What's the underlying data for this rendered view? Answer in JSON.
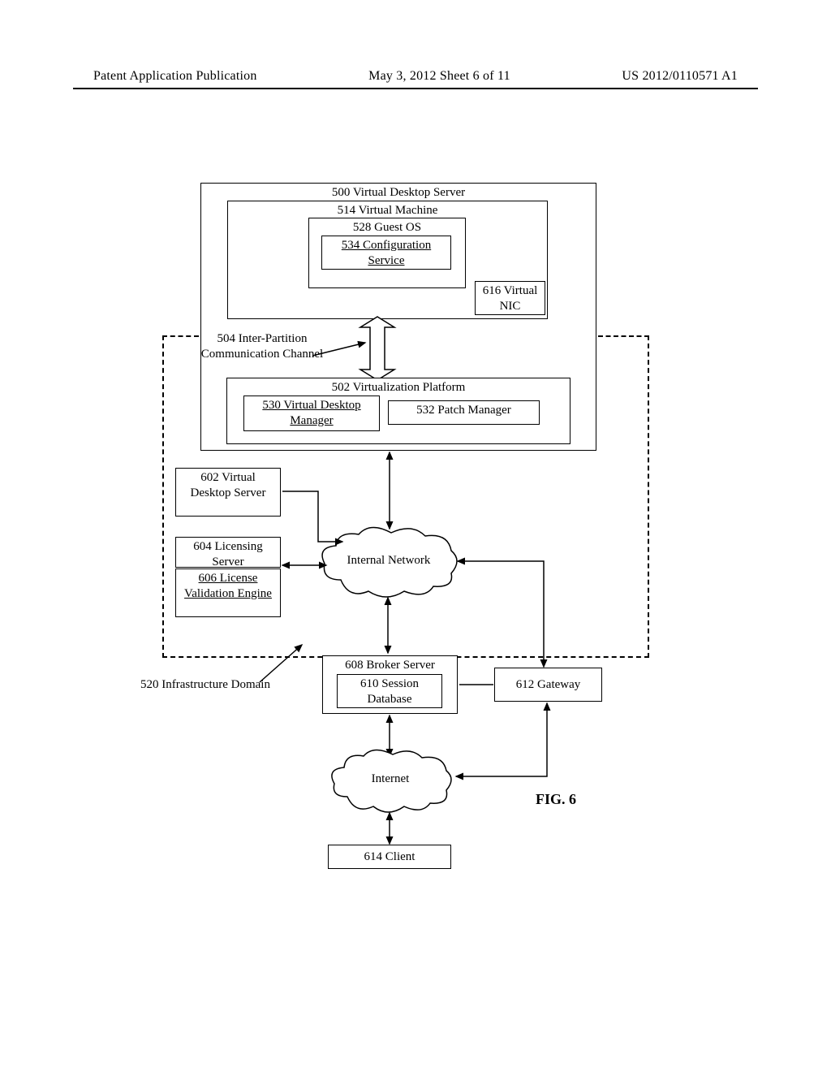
{
  "header": {
    "left": "Patent Application Publication",
    "mid": "May 3, 2012  Sheet 6 of 11",
    "right": "US 2012/0110571 A1"
  },
  "figure_label": "FIG. 6",
  "vds_outer_title": "500 Virtual Desktop Server",
  "vm": {
    "title": "514 Virtual Machine",
    "guest_os": "528 Guest OS",
    "config_service": "534 Configuration Service",
    "vnic": "616 Virtual NIC"
  },
  "ipc_channel": "504 Inter-Partition Communication Channel",
  "vplatform": {
    "title": "502 Virtualization Platform",
    "vdm": "530 Virtual Desktop Manager",
    "patch": "532 Patch Manager"
  },
  "second_vds": "602 Virtual Desktop Server",
  "licensing": {
    "server": "604 Licensing Server",
    "engine": "606 License Validation Engine"
  },
  "infra_domain_label": "520 Infrastructure Domain",
  "internal_network": "Internal Network",
  "broker": {
    "title": "608 Broker Server",
    "session_db": "610 Session Database"
  },
  "gateway": "612 Gateway",
  "internet": "Internet",
  "client": "614 Client"
}
